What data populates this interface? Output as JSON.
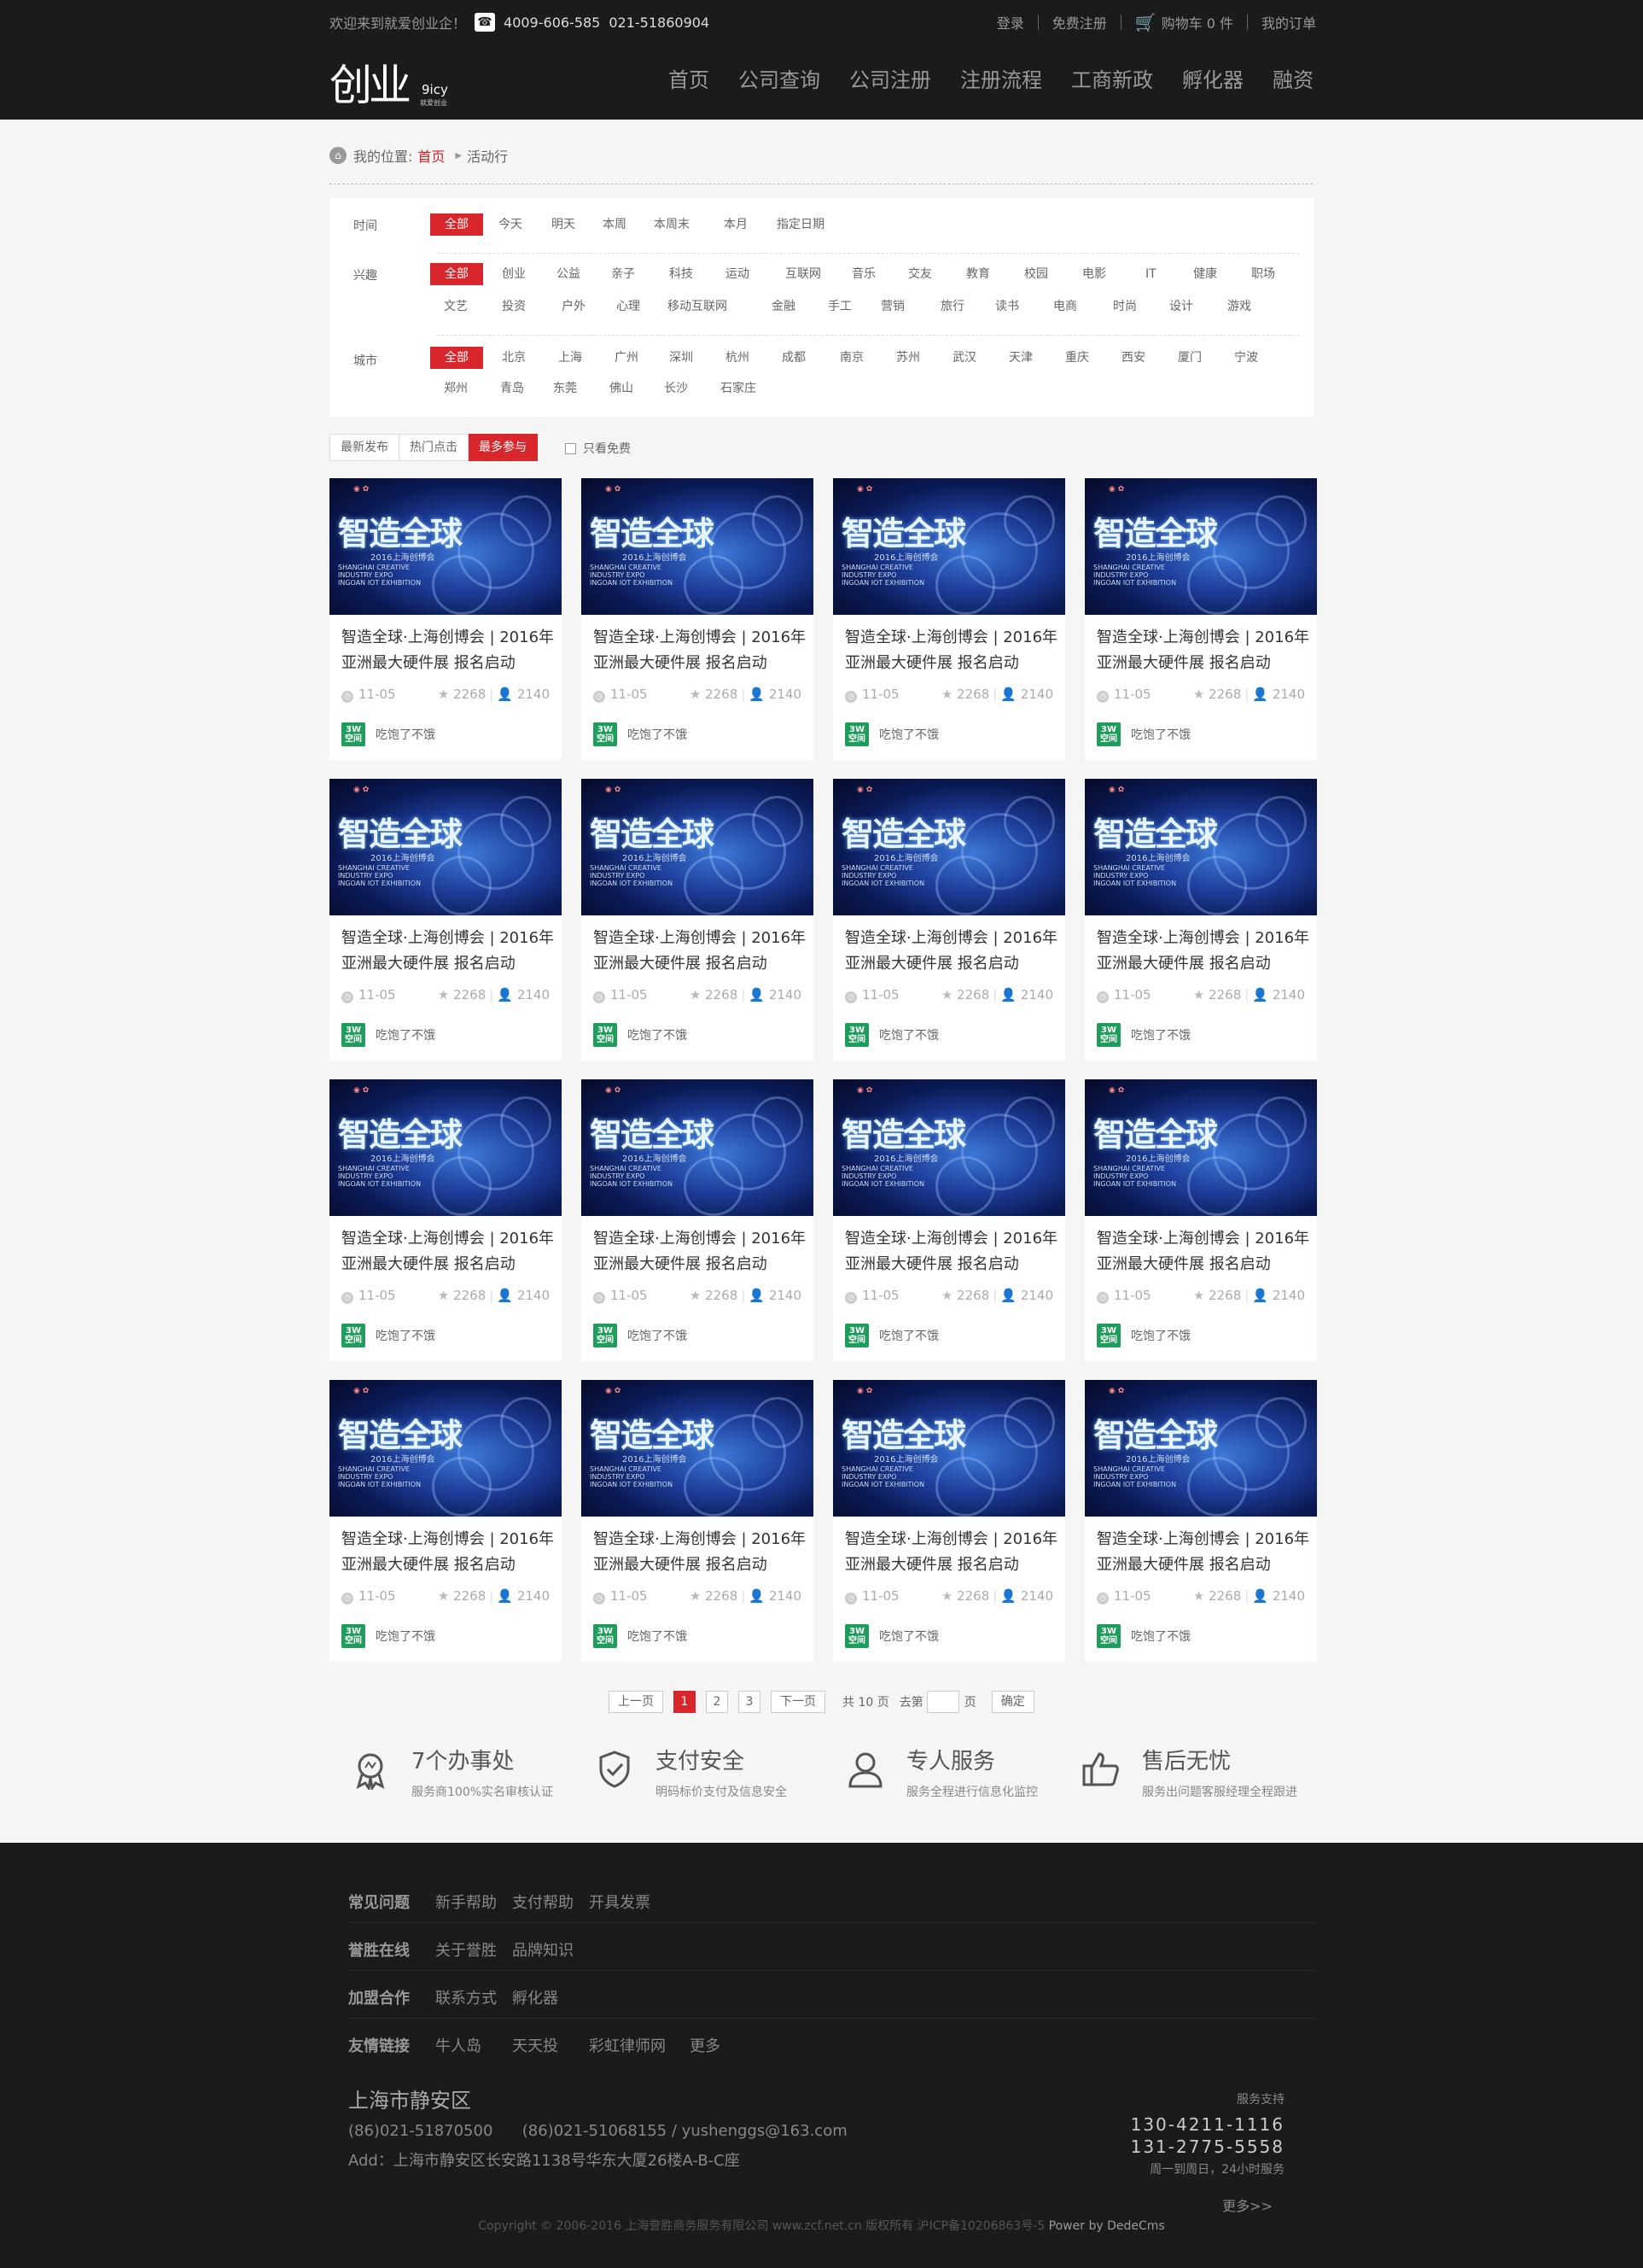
{
  "topbar": {
    "welcome": "欢迎来到就爱创业企！",
    "phone1": "4009-606-585",
    "phone2": "021-51860904",
    "login": "登录",
    "register": "免费注册",
    "cart": "购物车 0 件",
    "orders": "我的订单"
  },
  "logo": {
    "mark": "创业",
    "en": "9icy",
    "cn": "就爱创业"
  },
  "nav": [
    "首页",
    "公司查询",
    "公司注册",
    "注册流程",
    "工商新政",
    "孵化器",
    "融资"
  ],
  "breadcrumb": {
    "label": "我的位置:",
    "home": "首页",
    "current": "活动行"
  },
  "filters": {
    "time": {
      "label": "时间",
      "items": [
        "全部",
        "今天",
        "明天",
        "本周",
        "本周末",
        "本月",
        "指定日期"
      ]
    },
    "interest": {
      "label": "兴趣",
      "row1": [
        "全部",
        "创业",
        "公益",
        "亲子",
        "科技",
        "运动",
        "互联网",
        "音乐",
        "交友",
        "教育",
        "校园",
        "电影",
        "IT",
        "健康",
        "职场"
      ],
      "row2": [
        "文艺",
        "投资",
        "户外",
        "心理",
        "移动互联网",
        "金融",
        "手工",
        "营销",
        "旅行",
        "读书",
        "电商",
        "时尚",
        "设计",
        "游戏"
      ]
    },
    "city": {
      "label": "城市",
      "row1": [
        "全部",
        "北京",
        "上海",
        "广州",
        "深圳",
        "杭州",
        "成都",
        "南京",
        "苏州",
        "武汉",
        "天津",
        "重庆",
        "西安",
        "厦门",
        "宁波"
      ],
      "row2": [
        "郑州",
        "青岛",
        "东莞",
        "佛山",
        "长沙",
        "石家庄"
      ]
    }
  },
  "sort": {
    "latest": "最新发布",
    "hot": "热门点击",
    "most": "最多参与",
    "only_free": "只看免费"
  },
  "event": {
    "thumb_title": "智造全球",
    "thumb_sub": "2016上海创博会",
    "thumb_en": "SHANGHAI CREATIVE\nINDUSTRY EXPO\nINGOAN IOT EXHIBITION",
    "title": "智造全球·上海创博会 | 2016年亚洲最大硬件展 报名启动",
    "date": "11-05",
    "likes": "2268",
    "people": "2140",
    "org_badge": "3W\n空间",
    "org": "吃饱了不饿"
  },
  "pager": {
    "prev": "上一页",
    "pages": [
      "1",
      "2",
      "3"
    ],
    "next": "下一页",
    "total": "共 10 页",
    "goto": "去第",
    "page_unit": "页",
    "ok": "确定"
  },
  "features": [
    {
      "title": "7个办事处",
      "sub": "服务商100%实名审核认证",
      "icon": "medal-icon"
    },
    {
      "title": "支付安全",
      "sub": "明码标价支付及信息安全",
      "icon": "shield-icon"
    },
    {
      "title": "专人服务",
      "sub": "服务全程进行信息化监控",
      "icon": "user-icon"
    },
    {
      "title": "售后无忧",
      "sub": "服务出问题客服经理全程跟进",
      "icon": "thumbs-up-icon"
    }
  ],
  "footer": {
    "rows": [
      {
        "head": "常见问题",
        "links": [
          "新手帮助",
          "支付帮助",
          "开具发票"
        ]
      },
      {
        "head": "誉胜在线",
        "links": [
          "关于誉胜",
          "品牌知识"
        ]
      },
      {
        "head": "加盟合作",
        "links": [
          "联系方式",
          "孵化器"
        ]
      },
      {
        "head": "友情链接",
        "links": [
          "牛人岛",
          "天天投",
          "彩虹律师网",
          "更多"
        ]
      }
    ],
    "city": "上海市静安区",
    "line1": "(86)021-51870500      (86)021-51068155 / yushenggs@163.com",
    "line2": "Add：上海市静安区长安路1138号华东大厦26楼A-B-C座",
    "svc_label": "服务支持",
    "tel1": "130-4211-1116",
    "tel2": "131-2775-5558",
    "svc_hours": "周一到周日，24小时服务",
    "more": "更多>>",
    "copyright": "Copyright © 2006-2016 上海誉胜商务服务有限公司 www.zcf.net.cn  版权所有  沪ICP备10206863号-5",
    "power": "Power by DedeCms"
  }
}
